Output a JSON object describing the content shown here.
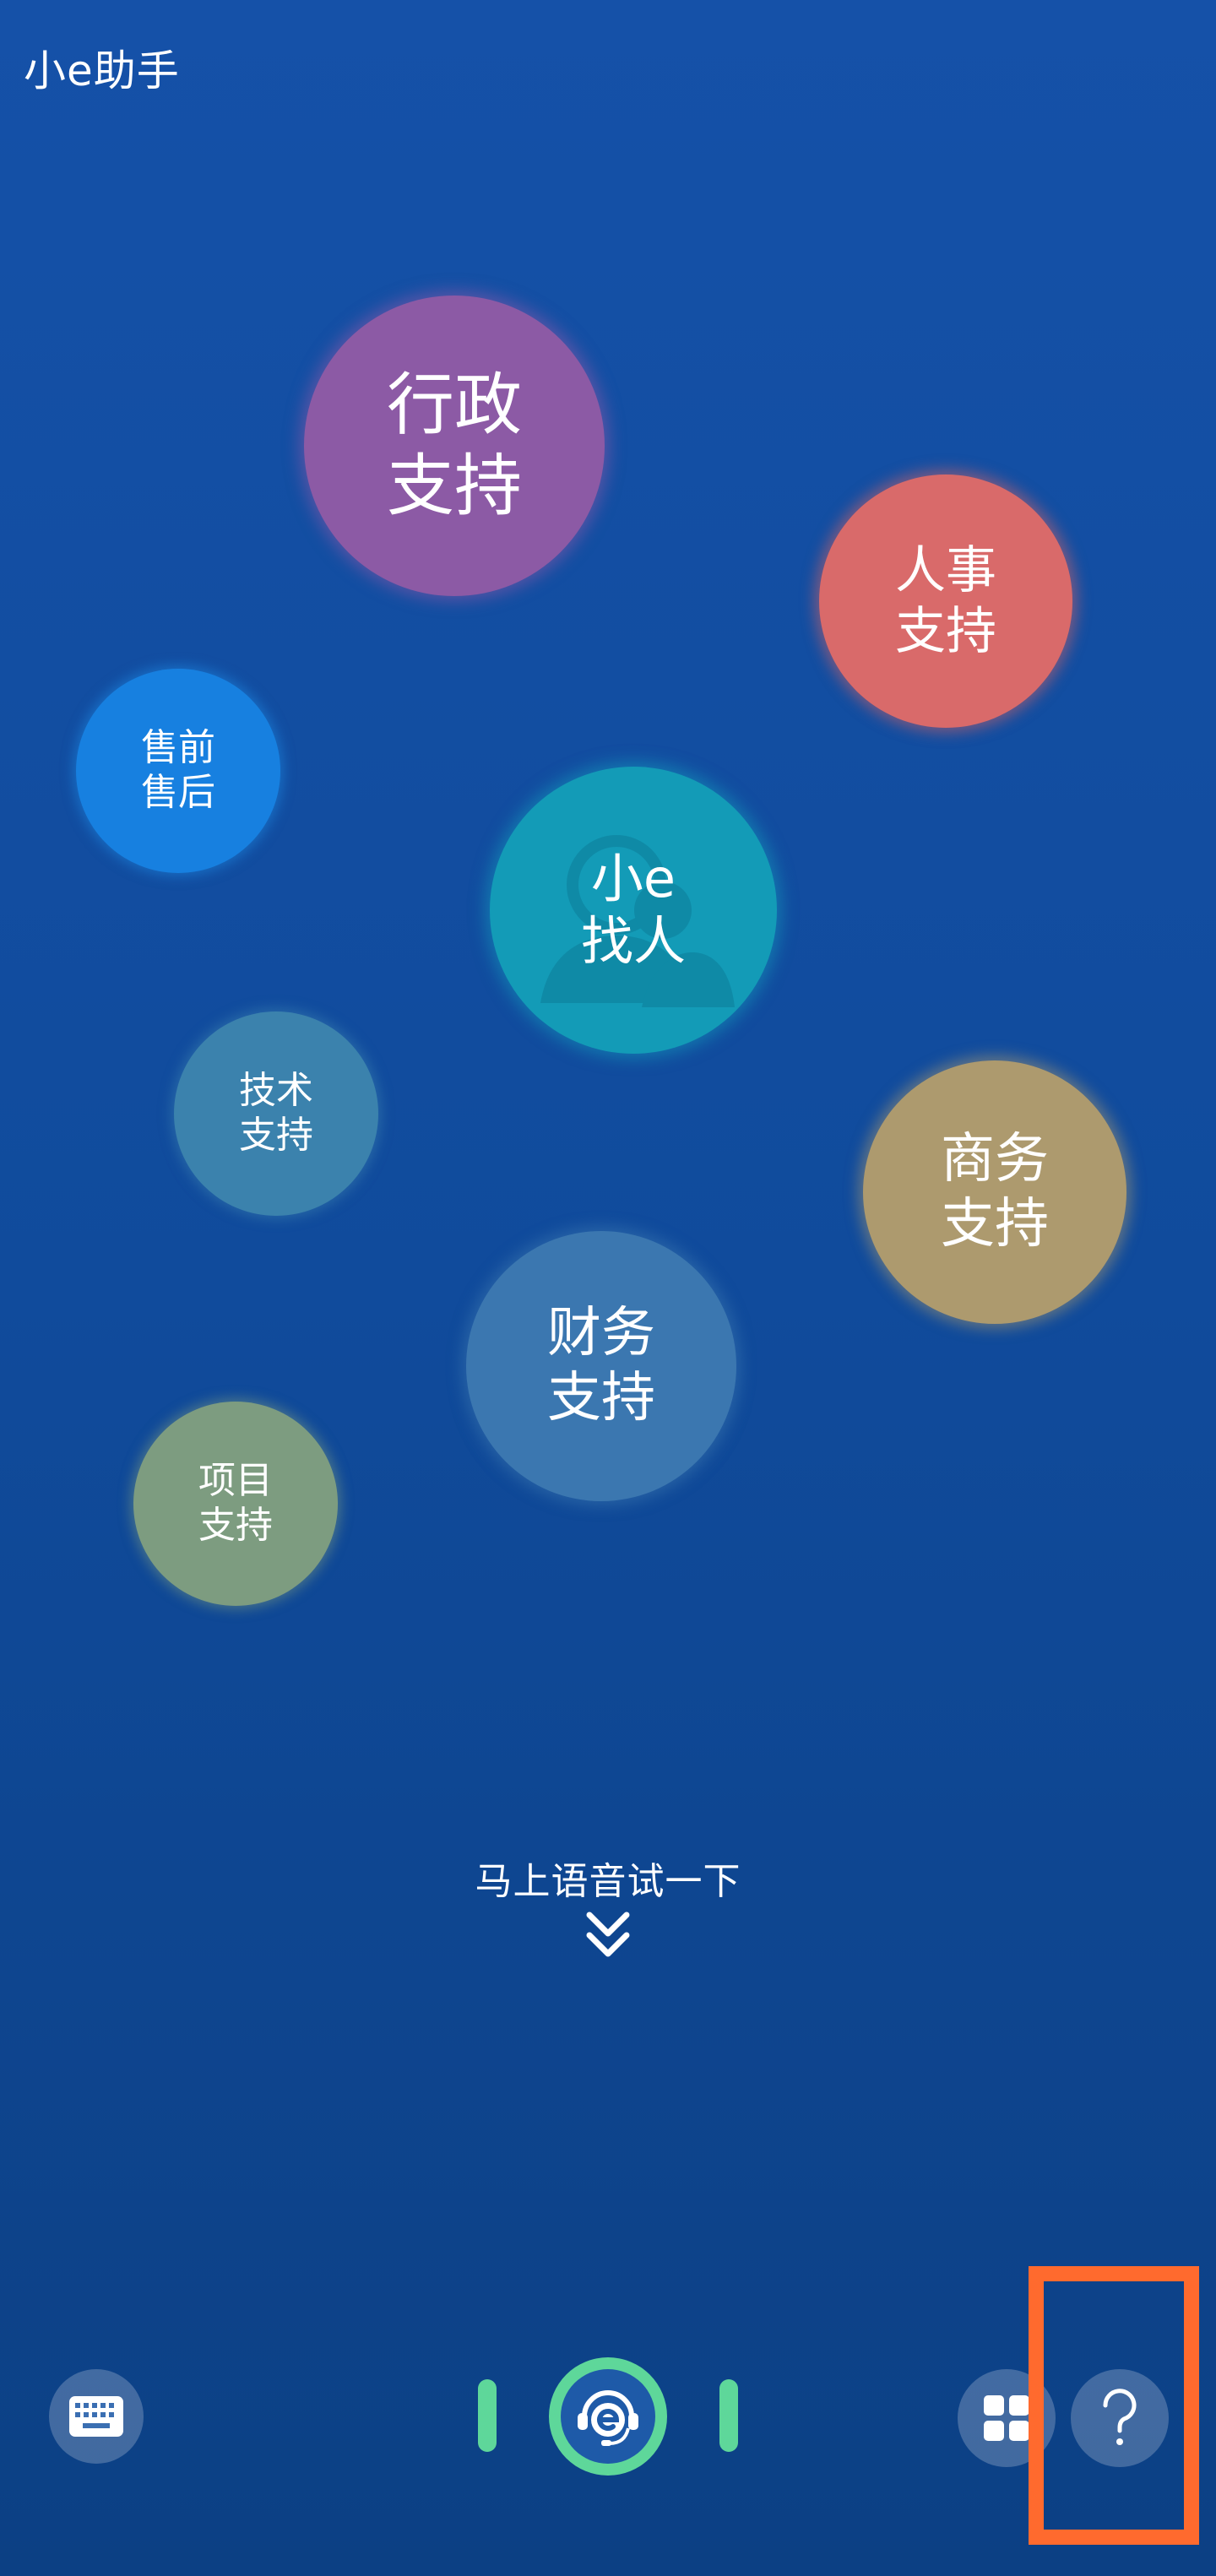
{
  "header": {
    "title": "小e助手"
  },
  "bubbles": {
    "admin": {
      "line1": "行政",
      "line2": "支持"
    },
    "hr": {
      "line1": "人事",
      "line2": "支持"
    },
    "presale": {
      "line1": "售前",
      "line2": "售后"
    },
    "find": {
      "line1": "小e",
      "line2": "找人"
    },
    "tech": {
      "line1": "技术",
      "line2": "支持"
    },
    "biz": {
      "line1": "商务",
      "line2": "支持"
    },
    "finance": {
      "line1": "财务",
      "line2": "支持"
    },
    "project": {
      "line1": "项目",
      "line2": "支持"
    }
  },
  "voice_prompt": {
    "text": "马上语音试一下"
  },
  "toolbar": {
    "keyboard_icon": "keyboard-icon",
    "voice_icon": "headset-e-icon",
    "grid_icon": "grid-icon",
    "help_icon": "question-mark-icon"
  },
  "colors": {
    "background": "#1551a8",
    "accent_green": "#5ed79a",
    "highlight": "#ff6a2e"
  }
}
